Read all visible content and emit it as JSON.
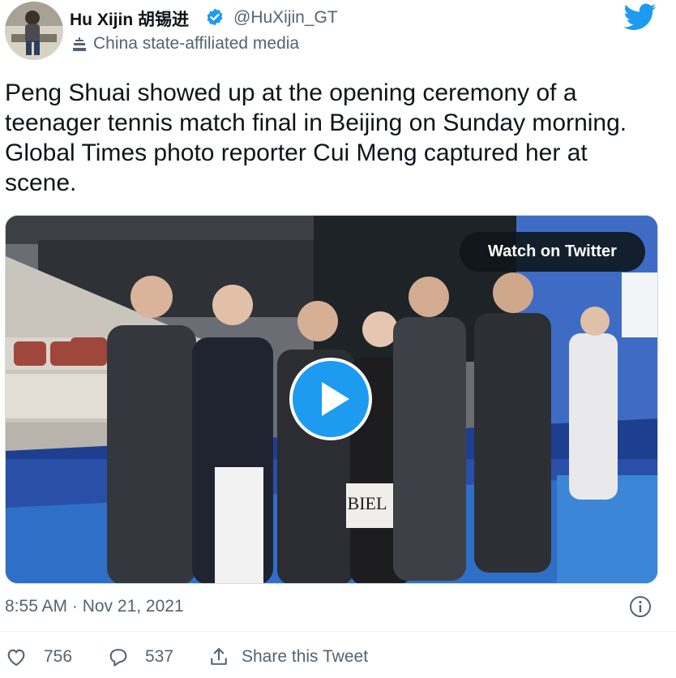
{
  "author": {
    "name": "Hu Xijin 胡锡进",
    "handle": "@HuXijin_GT",
    "affiliation": "China state-affiliated media",
    "verified": true
  },
  "tweet": {
    "text": "Peng Shuai showed up at the opening ceremony of a teenager tennis match final in Beijing on Sunday morning. Global Times photo reporter Cui Meng captured her at scene.",
    "timestamp": "8:55 AM · Nov 21, 2021"
  },
  "media": {
    "watch_label": "Watch on Twitter",
    "jacket_text": "BIEL"
  },
  "actions": {
    "likes": "756",
    "replies": "537",
    "share_label": "Share this Tweet"
  },
  "colors": {
    "accent": "#1d9bf0",
    "muted": "#536471",
    "text": "#0f1419"
  }
}
